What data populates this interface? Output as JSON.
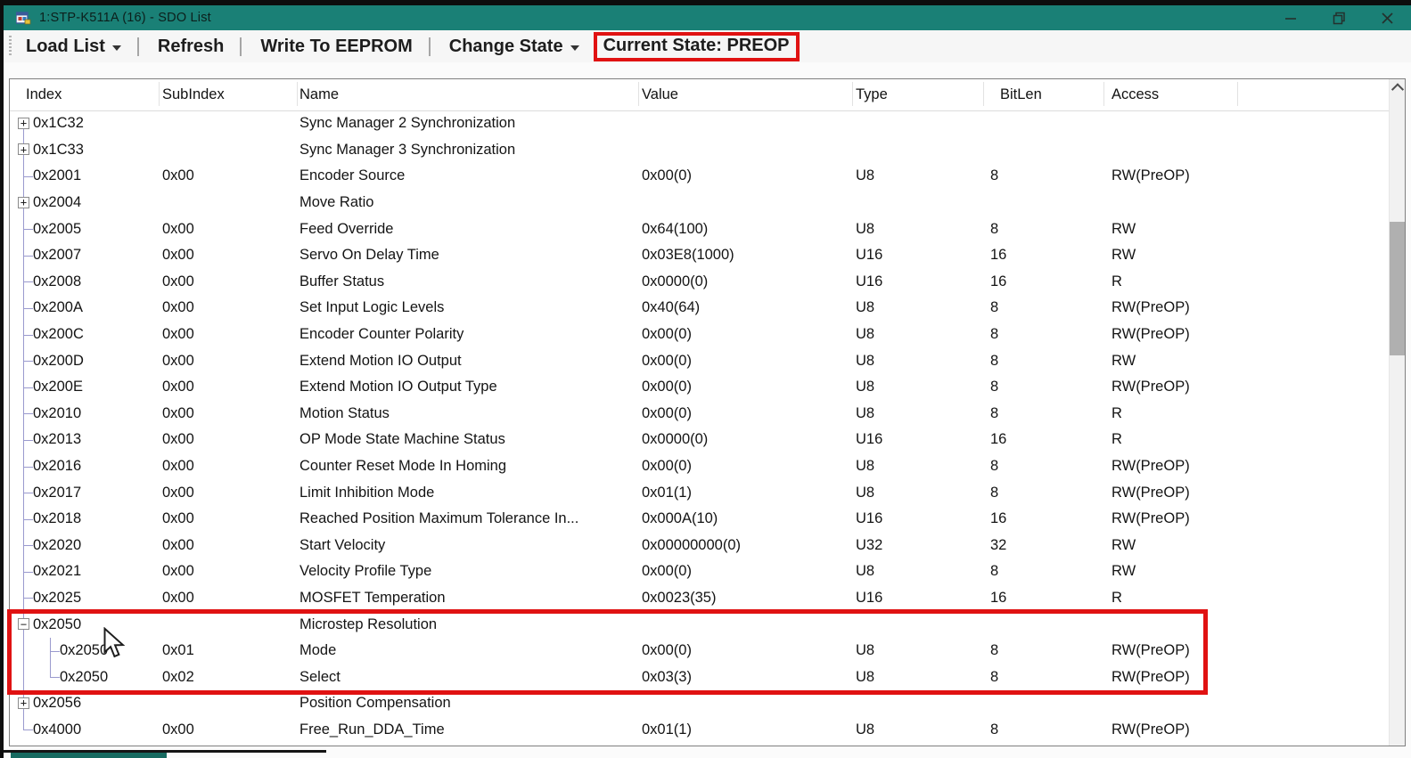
{
  "window": {
    "title": "1:STP-K511A (16) - SDO List"
  },
  "toolbar": {
    "load_list": "Load List",
    "refresh": "Refresh",
    "write_eeprom": "Write To EEPROM",
    "change_state": "Change State",
    "current_state": "Current State: PREOP"
  },
  "icons": {
    "expand_plus": "+",
    "expand_minus": "−",
    "dropdown": "caret-down",
    "scroll_up": "chevron-up",
    "minimize": "minimize-line",
    "restore": "overlapping-squares",
    "close": "x-cross"
  },
  "colors": {
    "titlebar_teal": "#1a8076",
    "annotation_red": "#e01212",
    "tree_line": "#9a9ace",
    "toolbar_bg": "#f6f6f6",
    "table_bg": "#ffffff"
  },
  "annotations": {
    "toolbar_highlight_target": "Current State: PREOP",
    "table_highlight_target": "Microstep Resolution group (0x2050 with subindexes 0x01, 0x02)"
  },
  "table": {
    "columns": [
      "Index",
      "SubIndex",
      "Name",
      "Value",
      "Type",
      "BitLen",
      "Access"
    ],
    "rows": [
      {
        "index": "0x1C32",
        "subindex": "",
        "name": "Sync Manager 2 Synchronization",
        "value": "",
        "type": "",
        "bitlen": "",
        "access": "",
        "node": "plus"
      },
      {
        "index": "0x1C33",
        "subindex": "",
        "name": "Sync Manager 3 Synchronization",
        "value": "",
        "type": "",
        "bitlen": "",
        "access": "",
        "node": "plus"
      },
      {
        "index": "0x2001",
        "subindex": "0x00",
        "name": "Encoder Source",
        "value": "0x00(0)",
        "type": "U8",
        "bitlen": "8",
        "access": "RW(PreOP)",
        "node": "leaf"
      },
      {
        "index": "0x2004",
        "subindex": "",
        "name": "Move Ratio",
        "value": "",
        "type": "",
        "bitlen": "",
        "access": "",
        "node": "plus"
      },
      {
        "index": "0x2005",
        "subindex": "0x00",
        "name": "Feed Override",
        "value": "0x64(100)",
        "type": "U8",
        "bitlen": "8",
        "access": "RW",
        "node": "leaf"
      },
      {
        "index": "0x2007",
        "subindex": "0x00",
        "name": "Servo On Delay Time",
        "value": "0x03E8(1000)",
        "type": "U16",
        "bitlen": "16",
        "access": "RW",
        "node": "leaf"
      },
      {
        "index": "0x2008",
        "subindex": "0x00",
        "name": "Buffer Status",
        "value": "0x0000(0)",
        "type": "U16",
        "bitlen": "16",
        "access": "R",
        "node": "leaf"
      },
      {
        "index": "0x200A",
        "subindex": "0x00",
        "name": "Set Input Logic Levels",
        "value": "0x40(64)",
        "type": "U8",
        "bitlen": "8",
        "access": "RW(PreOP)",
        "node": "leaf"
      },
      {
        "index": "0x200C",
        "subindex": "0x00",
        "name": "Encoder Counter Polarity",
        "value": "0x00(0)",
        "type": "U8",
        "bitlen": "8",
        "access": "RW(PreOP)",
        "node": "leaf"
      },
      {
        "index": "0x200D",
        "subindex": "0x00",
        "name": "Extend Motion IO Output",
        "value": "0x00(0)",
        "type": "U8",
        "bitlen": "8",
        "access": "RW",
        "node": "leaf"
      },
      {
        "index": "0x200E",
        "subindex": "0x00",
        "name": "Extend Motion IO Output Type",
        "value": "0x00(0)",
        "type": "U8",
        "bitlen": "8",
        "access": "RW(PreOP)",
        "node": "leaf"
      },
      {
        "index": "0x2010",
        "subindex": "0x00",
        "name": "Motion Status",
        "value": "0x00(0)",
        "type": "U8",
        "bitlen": "8",
        "access": "R",
        "node": "leaf"
      },
      {
        "index": "0x2013",
        "subindex": "0x00",
        "name": "OP Mode State Machine Status",
        "value": "0x0000(0)",
        "type": "U16",
        "bitlen": "16",
        "access": "R",
        "node": "leaf"
      },
      {
        "index": "0x2016",
        "subindex": "0x00",
        "name": "Counter Reset Mode In Homing",
        "value": "0x00(0)",
        "type": "U8",
        "bitlen": "8",
        "access": "RW(PreOP)",
        "node": "leaf"
      },
      {
        "index": "0x2017",
        "subindex": "0x00",
        "name": "Limit Inhibition Mode",
        "value": "0x01(1)",
        "type": "U8",
        "bitlen": "8",
        "access": "RW(PreOP)",
        "node": "leaf"
      },
      {
        "index": "0x2018",
        "subindex": "0x00",
        "name": "Reached Position Maximum Tolerance In...",
        "value": "0x000A(10)",
        "type": "U16",
        "bitlen": "16",
        "access": "RW(PreOP)",
        "node": "leaf"
      },
      {
        "index": "0x2020",
        "subindex": "0x00",
        "name": "Start Velocity",
        "value": "0x00000000(0)",
        "type": "U32",
        "bitlen": "32",
        "access": "RW",
        "node": "leaf"
      },
      {
        "index": "0x2021",
        "subindex": "0x00",
        "name": "Velocity Profile Type",
        "value": "0x00(0)",
        "type": "U8",
        "bitlen": "8",
        "access": "RW",
        "node": "leaf"
      },
      {
        "index": "0x2025",
        "subindex": "0x00",
        "name": "MOSFET Temperation",
        "value": "0x0023(35)",
        "type": "U16",
        "bitlen": "16",
        "access": "R",
        "node": "leaf"
      },
      {
        "index": "0x2050",
        "subindex": "",
        "name": "Microstep Resolution",
        "value": "",
        "type": "",
        "bitlen": "",
        "access": "",
        "node": "minus"
      },
      {
        "index": "0x2050",
        "subindex": "0x01",
        "name": "Mode",
        "value": "0x00(0)",
        "type": "U8",
        "bitlen": "8",
        "access": "RW(PreOP)",
        "node": "child"
      },
      {
        "index": "0x2050",
        "subindex": "0x02",
        "name": "Select",
        "value": "0x03(3)",
        "type": "U8",
        "bitlen": "8",
        "access": "RW(PreOP)",
        "node": "child-last"
      },
      {
        "index": "0x2056",
        "subindex": "",
        "name": "Position Compensation",
        "value": "",
        "type": "",
        "bitlen": "",
        "access": "",
        "node": "plus"
      },
      {
        "index": "0x4000",
        "subindex": "0x00",
        "name": "Free_Run_DDA_Time",
        "value": "0x01(1)",
        "type": "U8",
        "bitlen": "8",
        "access": "RW(PreOP)",
        "node": "leaf"
      }
    ]
  }
}
